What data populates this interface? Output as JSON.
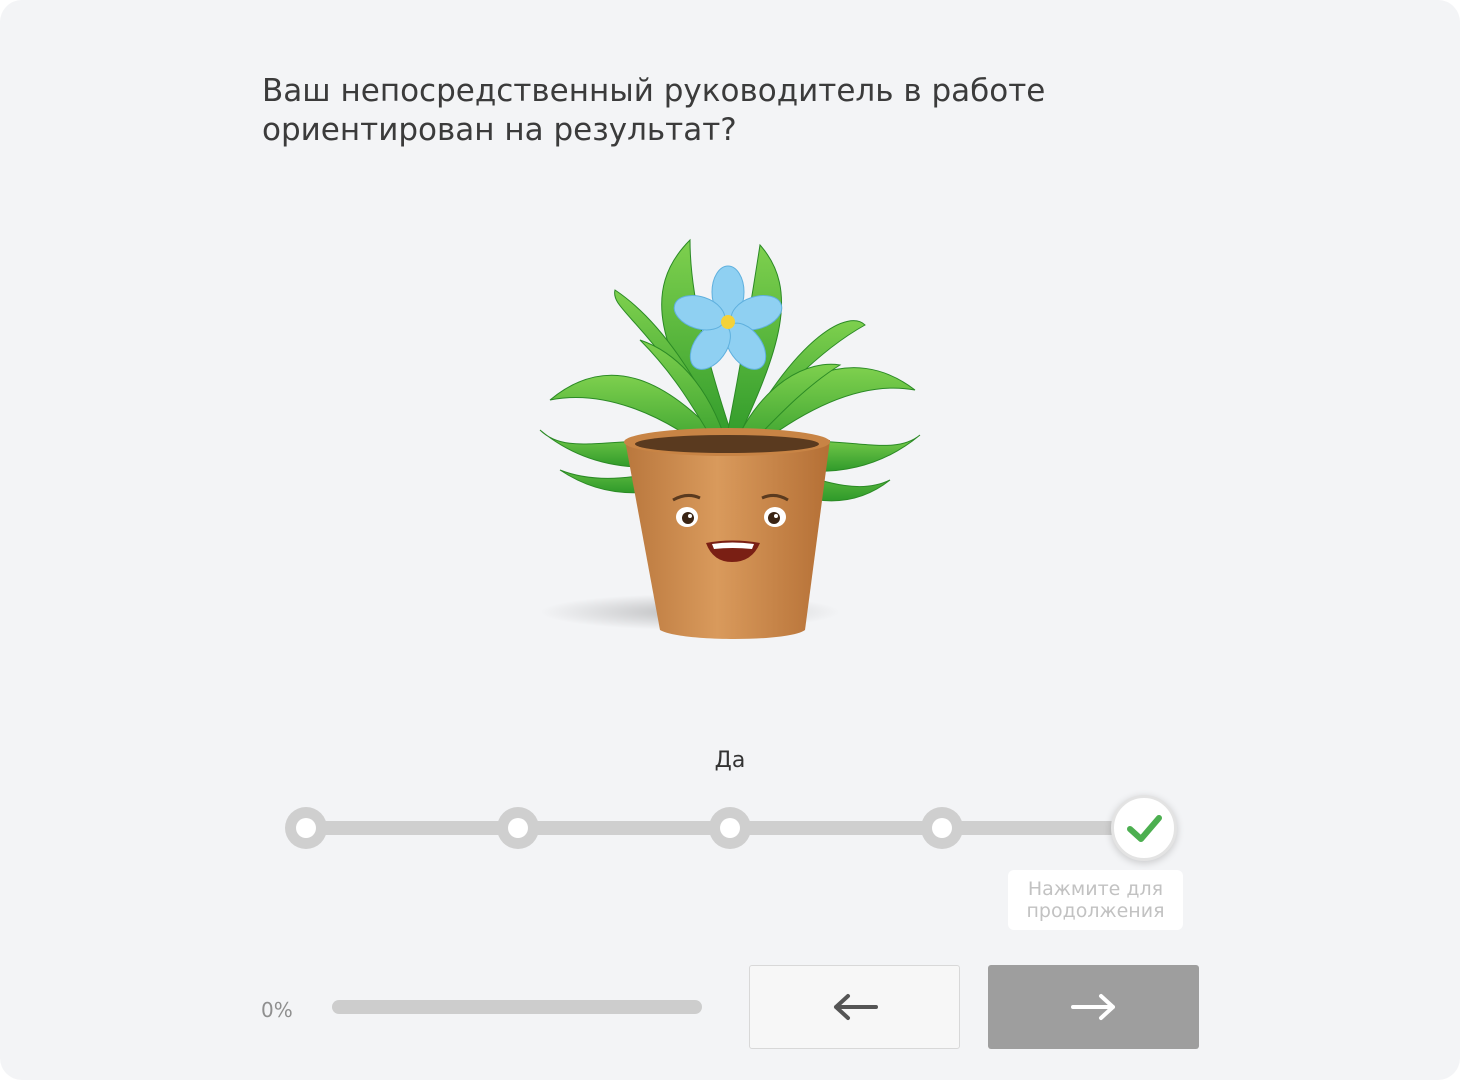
{
  "question": {
    "line1": "Ваш непосредственный руководитель в работе",
    "line2": "ориентирован на результат?"
  },
  "illustration": {
    "icon": "smiling-potted-plant-illustration"
  },
  "scale": {
    "selected_label": "Да",
    "points": 5,
    "selected_index": 4,
    "selected_icon": "checkmark-icon",
    "hint_line1": "Нажмите для",
    "hint_line2": "продолжения"
  },
  "progress": {
    "label": "0%",
    "value": 0
  },
  "navigation": {
    "back_icon": "arrow-left-icon",
    "next_icon": "arrow-right-icon"
  },
  "colors": {
    "background": "#f3f4f6",
    "track": "#cfcfcf",
    "check": "#4caf50",
    "next_button": "#9e9e9e"
  }
}
